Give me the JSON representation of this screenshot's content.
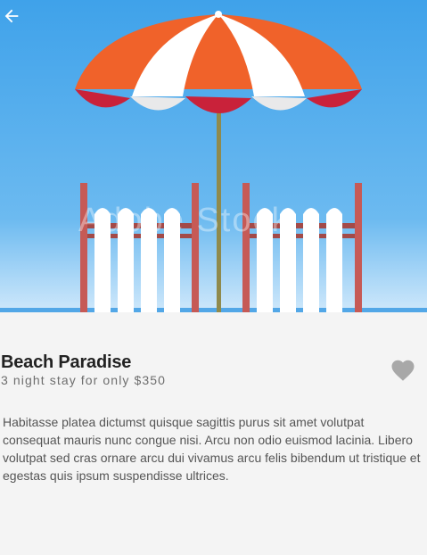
{
  "hero": {
    "watermark_text": "Adobe Stock",
    "sky_color": "#4aa9ec",
    "umbrella_colors": [
      "#f06a2c",
      "#ffffff",
      "#c92a3a"
    ]
  },
  "toolbar": {
    "back_icon": "arrow-left-icon"
  },
  "listing": {
    "title": "Beach Paradise",
    "subtitle": "3 night stay for only $350",
    "favorite_icon": "heart-icon",
    "description": "Habitasse platea dictumst quisque sagittis purus sit amet volutpat consequat mauris nunc congue nisi. Arcu non odio euismod lacinia. Libero volutpat sed cras ornare arcu dui vivamus arcu felis bibendum ut tristique et egestas quis ipsum suspendisse ultrices."
  }
}
